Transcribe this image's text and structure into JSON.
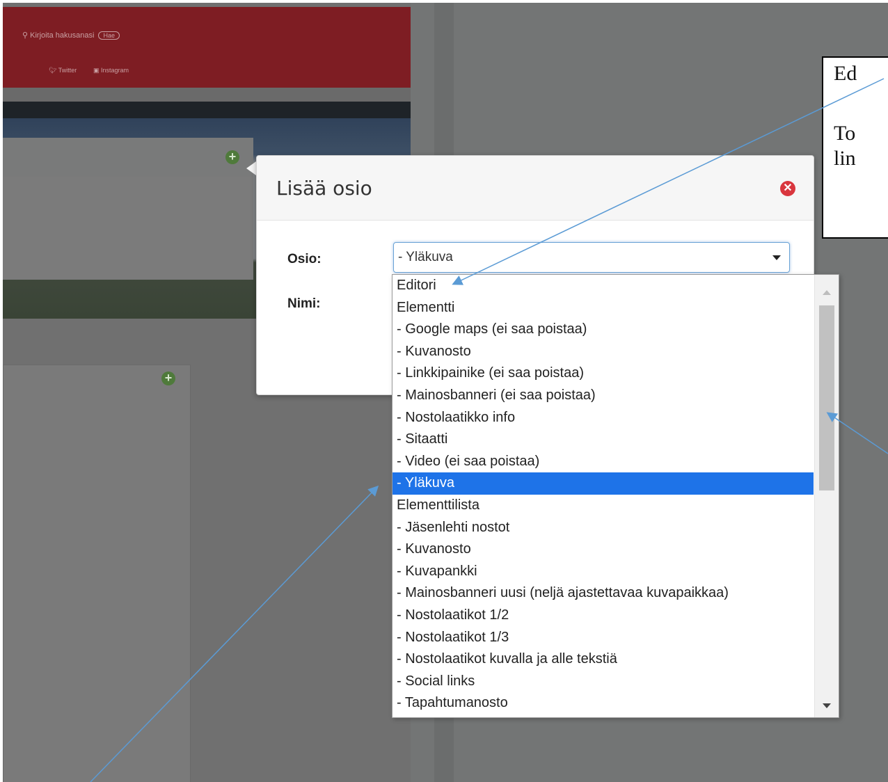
{
  "background_page": {
    "search_placeholder": "Kirjoita hakusanasi",
    "search_badge": "Hae",
    "social_twitter": "Twitter",
    "social_instagram": "Instagram"
  },
  "dialog": {
    "title": "Lisää osio",
    "close_icon": "close-icon",
    "osio_label": "Osio:",
    "nimi_label": "Nimi:",
    "selected_value": "- Yläkuva"
  },
  "dropdown": {
    "options": [
      "Editori",
      "Elementti",
      "- Google maps (ei saa poistaa)",
      "- Kuvanosto",
      "- Linkkipainike (ei saa poistaa)",
      "- Mainosbanneri (ei saa poistaa)",
      "- Nostolaatikko info",
      "- Sitaatti",
      "- Video (ei saa poistaa)",
      "- Yläkuva",
      "Elementtilista",
      "- Jäsenlehti nostot",
      "- Kuvanosto",
      "- Kuvapankki",
      "- Mainosbanneri uusi (neljä ajastettavaa kuvapaikkaa)",
      "- Nostolaatikot 1/2",
      "- Nostolaatikot 1/3",
      "- Nostolaatikot kuvalla ja alle tekstiä",
      "- Social links",
      "- Tapahtumanosto"
    ],
    "selected_index": 9
  },
  "annotation": {
    "line1": "Ed",
    "line2": "To",
    "line3": "lin"
  },
  "colors": {
    "highlight": "#1e73e8",
    "arrow": "#5b9bd5",
    "close_red": "#d9363e",
    "add_green": "#4f7a3b"
  }
}
